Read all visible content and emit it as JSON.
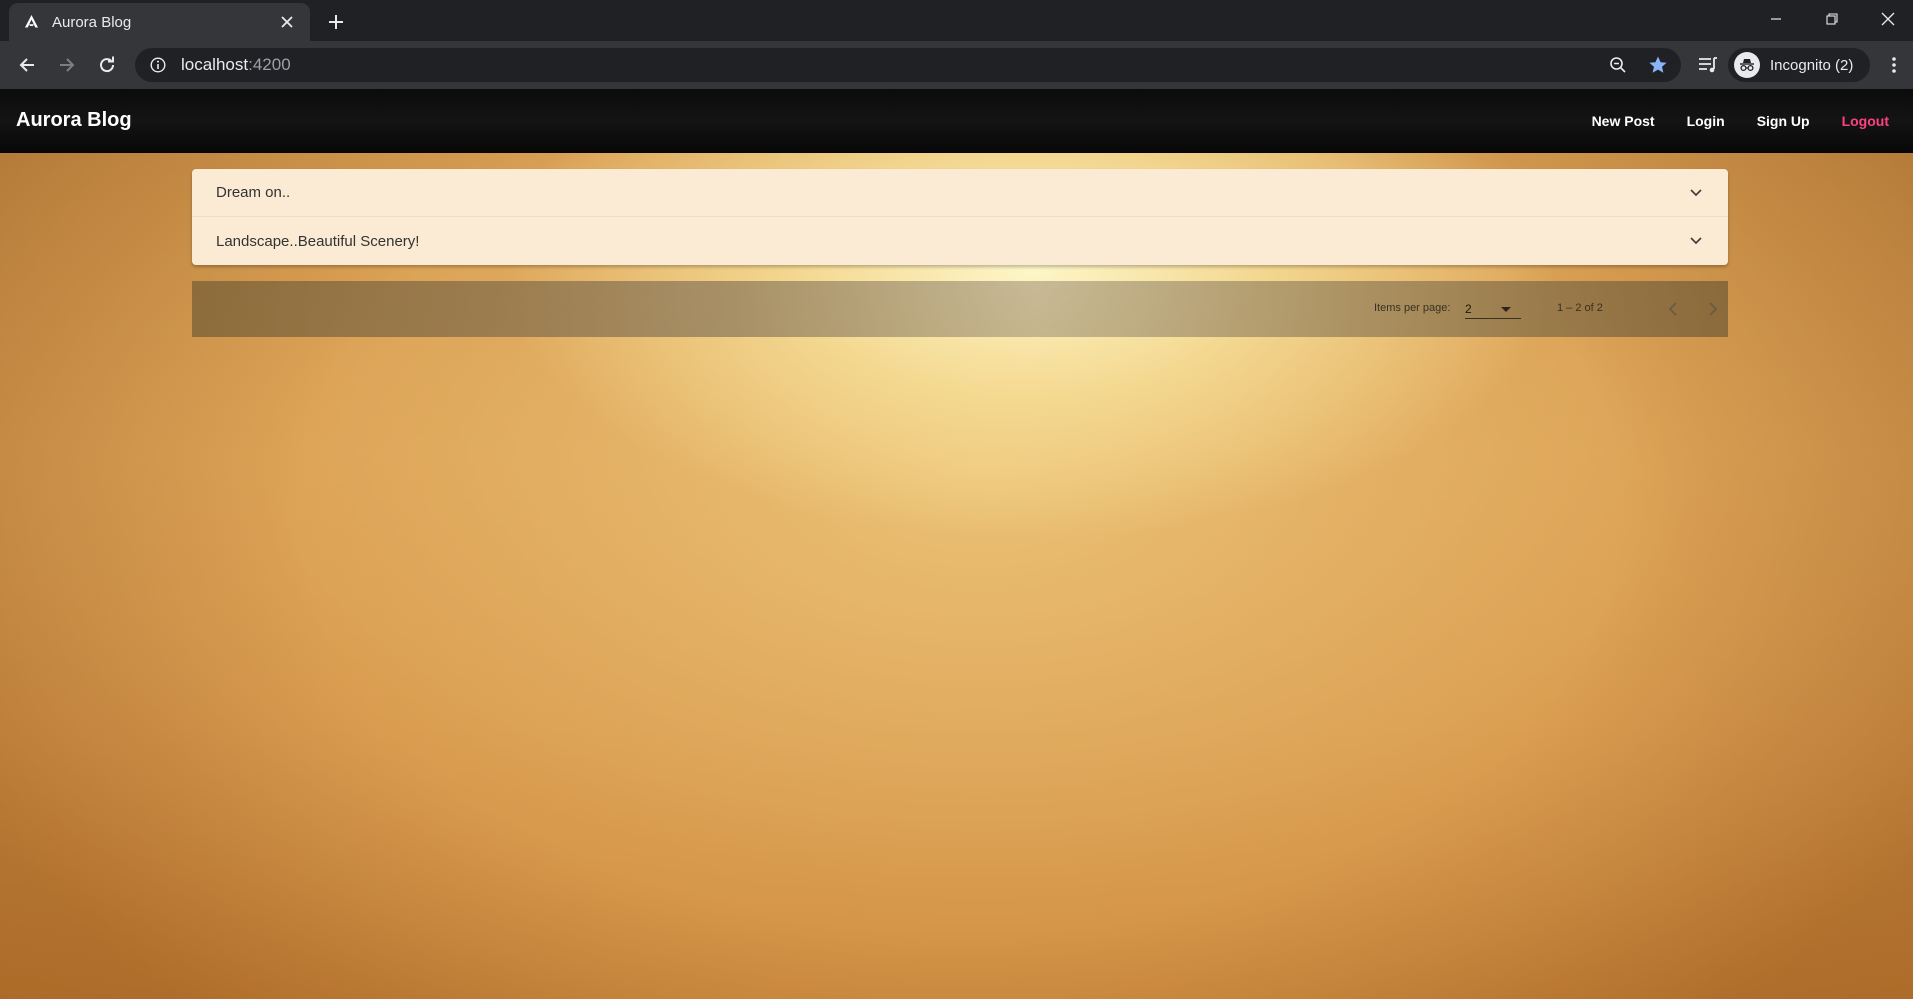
{
  "browser": {
    "tab_title": "Aurora Blog",
    "url_host": "localhost",
    "url_port": ":4200",
    "profile_label": "Incognito (2)"
  },
  "app": {
    "brand": "Aurora Blog",
    "nav": {
      "new_post": "New Post",
      "login": "Login",
      "signup": "Sign Up",
      "logout": "Logout"
    },
    "logout_color": "#ff4081"
  },
  "posts": [
    {
      "title": "Dream on.."
    },
    {
      "title": "Landscape..Beautiful Scenery!"
    }
  ],
  "paginator": {
    "items_per_page_label": "Items per page:",
    "page_size": "2",
    "range_label": "1 – 2 of 2"
  }
}
